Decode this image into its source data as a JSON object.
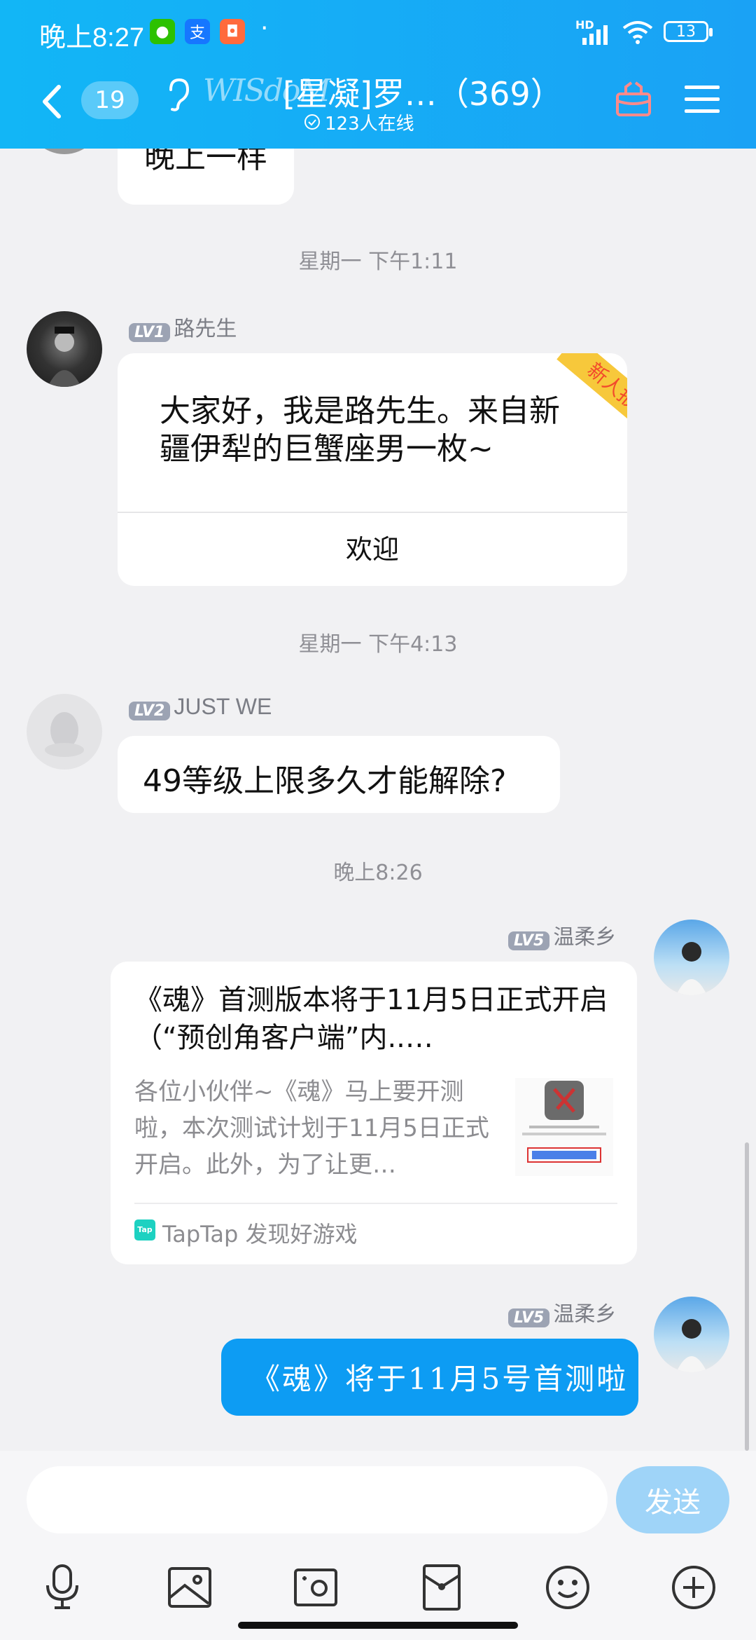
{
  "status_bar": {
    "time": "晚上8:27",
    "dot": "·",
    "hd": "HD",
    "battery": "13"
  },
  "header": {
    "back_count": "19",
    "group_logo_text": "WISdoM",
    "title": "[星凝]罗…（369）",
    "online": "123人在线"
  },
  "messages": [
    {
      "type": "partial",
      "text": "晚上一样"
    },
    {
      "type": "time",
      "text": "星期一 下午1:11"
    },
    {
      "type": "newcomer",
      "level": "LV1",
      "name": "路先生",
      "text": "大家好，我是路先生。来自新疆伊犁的巨蟹座男一枚~",
      "ribbon": "新人报到",
      "action": "欢迎"
    },
    {
      "type": "time",
      "text": "星期一 下午4:13"
    },
    {
      "type": "text",
      "level": "LV2",
      "name": "JUST WE",
      "text": "49等级上限多久才能解除?"
    },
    {
      "type": "time",
      "text": "晚上8:26"
    },
    {
      "type": "card",
      "level": "LV5",
      "name": "温柔乡",
      "title": "《魂》首测版本将于11月5日正式开启（“预创角客户端”内..…",
      "desc": "各位小伙伴~《魂》马上要开测啦，本次测试计划于11月5日正式开启。此外，为了让更…",
      "source_icon": "Tap",
      "source": "TapTap 发现好游戏"
    },
    {
      "type": "self",
      "level": "LV5",
      "name": "温柔乡",
      "text": "《魂》将于11月5号首测啦"
    }
  ],
  "input": {
    "placeholder": "",
    "send_label": "发送"
  },
  "colors": {
    "header": "#14aef6",
    "self_bubble": "#0d9cf3",
    "send_button": "#9fd4f8",
    "ribbon": "#f7c83b"
  },
  "icons": [
    "back-icon",
    "ear-icon",
    "gift-icon",
    "menu-icon",
    "mic-icon",
    "image-icon",
    "camera-icon",
    "redpacket-icon",
    "emoji-icon",
    "plus-icon"
  ]
}
